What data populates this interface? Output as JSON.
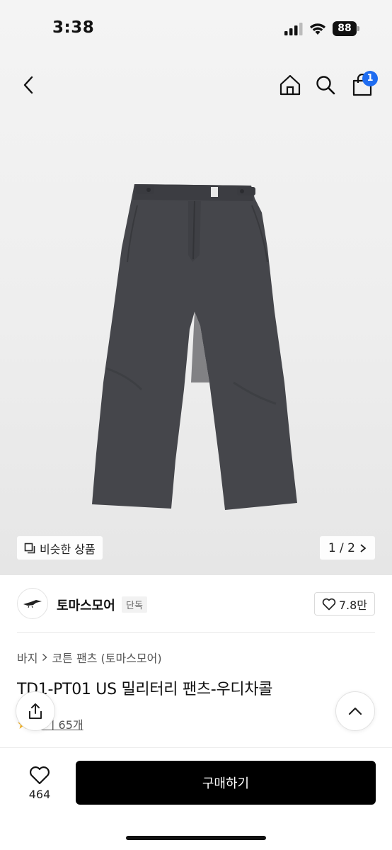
{
  "status_bar": {
    "time": "3:38",
    "battery": "88"
  },
  "nav": {
    "cart_count": "1"
  },
  "gallery": {
    "similar_label": "비슷한 상품",
    "pager": "1 / 2"
  },
  "brand": {
    "name": "토마스모어",
    "tag": "단독",
    "likes": "7.8만"
  },
  "breadcrumb": {
    "category": "바지",
    "subcategory": "코튼 팬츠 (토마스모어)"
  },
  "product": {
    "title": "TD1-PT01 US 밀리터리 팬츠-우디차콜",
    "reviews": "후기 65개"
  },
  "bottom_bar": {
    "wish_count": "464",
    "buy_label": "구매하기"
  },
  "colors": {
    "accent": "#1f6cf0",
    "buy_button": "#000000",
    "pants": "#45464b"
  },
  "icons": [
    "back-chevron-icon",
    "home-icon",
    "search-icon",
    "shopping-bag-icon",
    "copy-icon",
    "chevron-right-icon",
    "heart-icon",
    "share-icon",
    "chevron-up-icon",
    "star-icon"
  ]
}
